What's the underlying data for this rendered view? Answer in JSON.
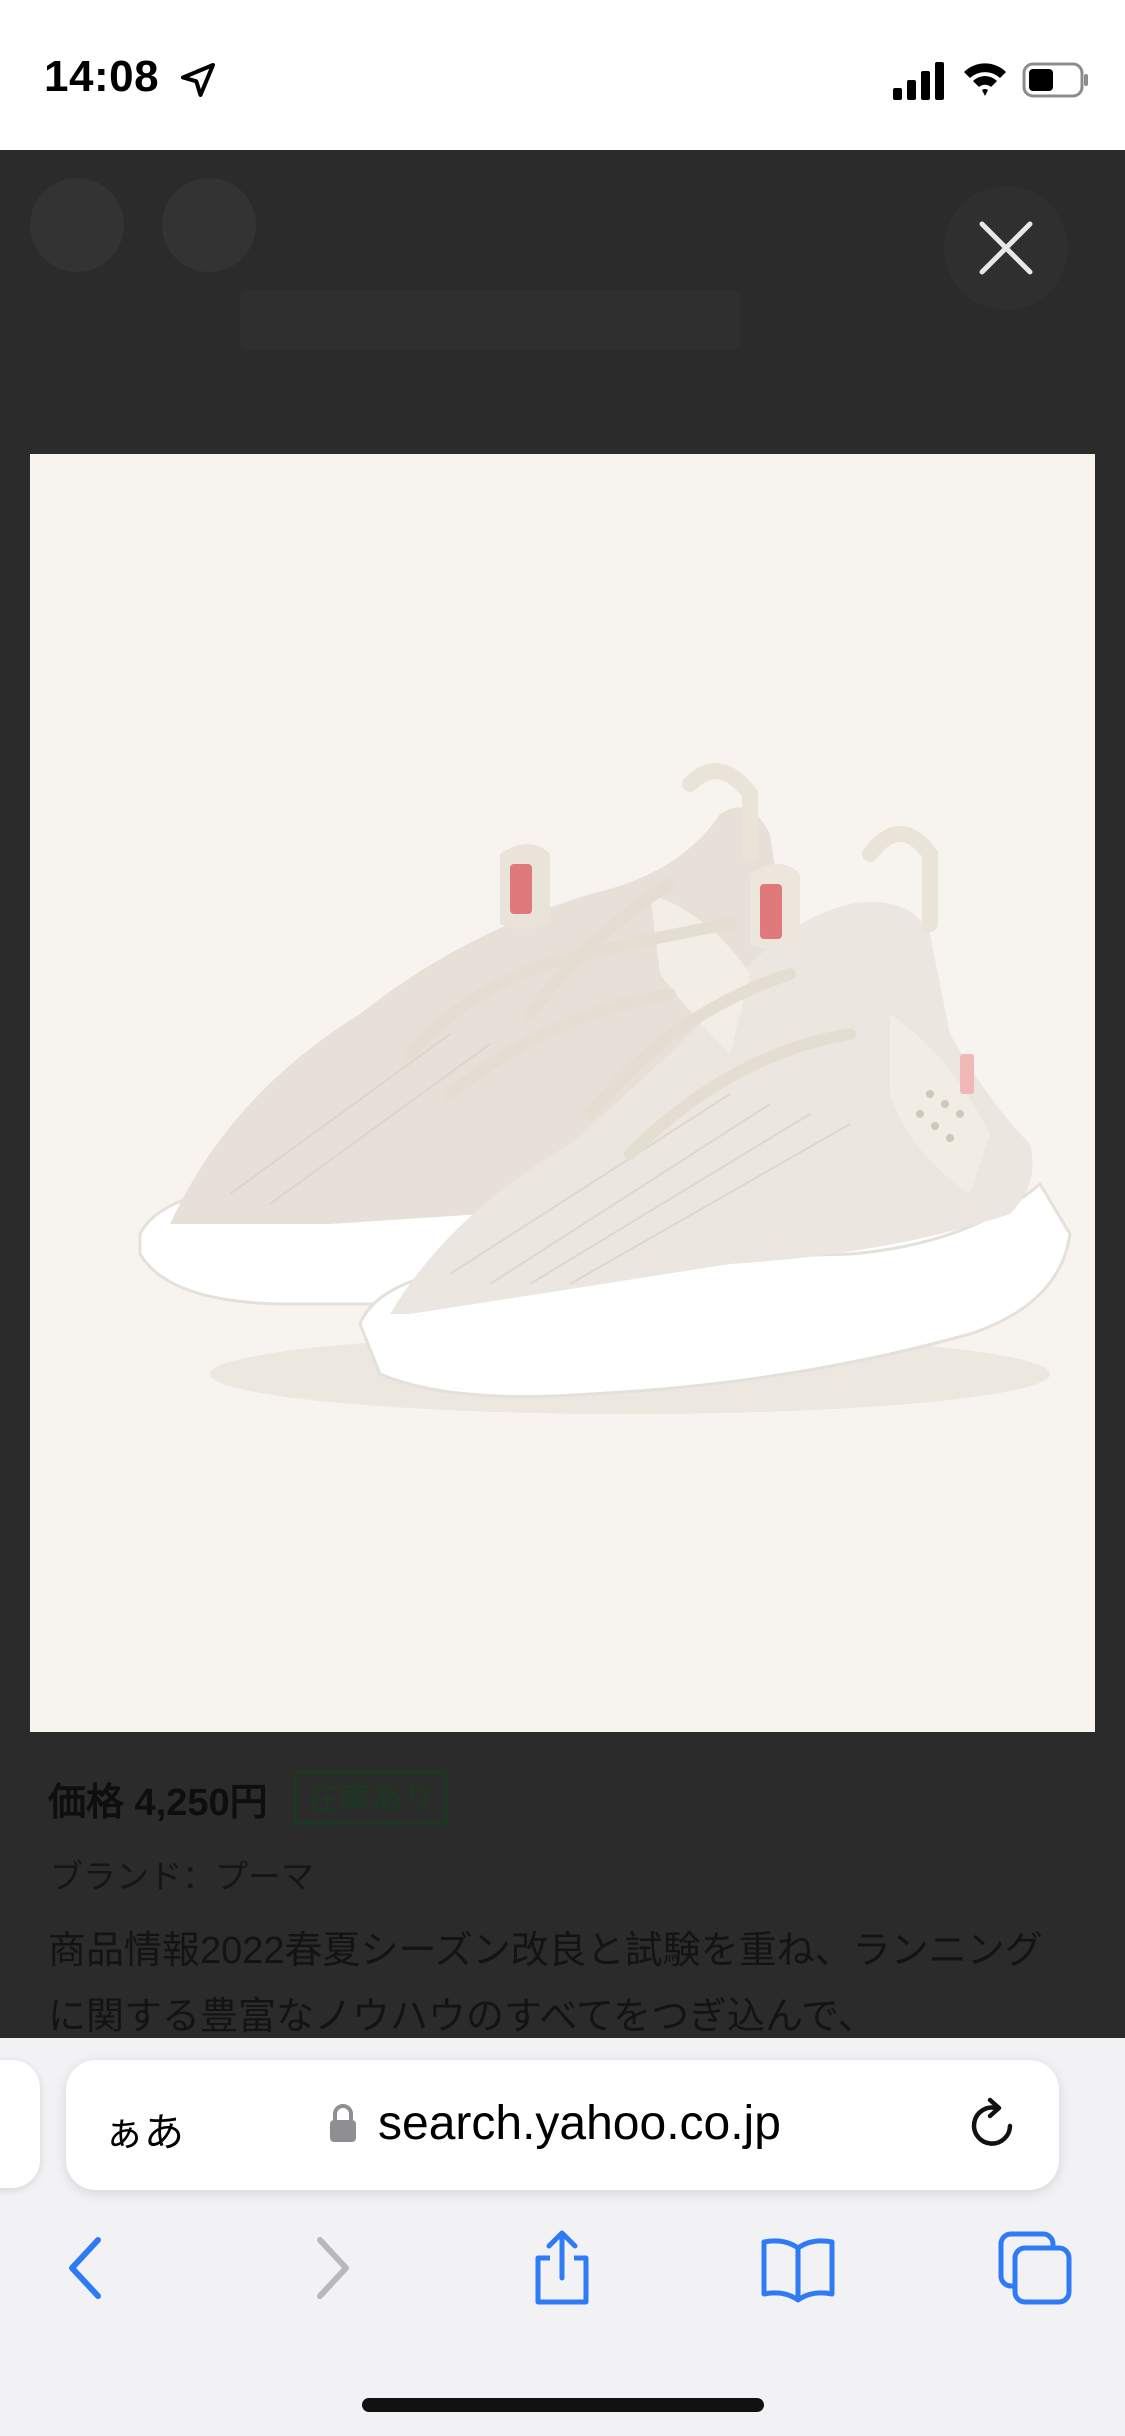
{
  "status_bar": {
    "time": "14:08"
  },
  "product": {
    "price": "価格 4,250円",
    "stock_badge": "在庫あり",
    "brand": "ブランド：プーマ",
    "description": "商品情報2022春夏シーズン改良と試験を重ね、ランニングに関する豊富なノウハウのすべてをつぎ込んで、"
  },
  "address_bar": {
    "text_size_label": "ぁあ",
    "url": "search.yahoo.co.jp"
  },
  "icons": {
    "close": "close-icon",
    "back": "chevron-left-icon",
    "forward": "chevron-right-icon",
    "share": "share-icon",
    "bookmarks": "book-icon",
    "tabs": "tabs-icon",
    "reload": "reload-icon",
    "lock": "lock-icon"
  },
  "colors": {
    "accent": "#2f7bf5",
    "disabled": "#b8b8bc",
    "stock_badge": "#1a3a1f"
  }
}
